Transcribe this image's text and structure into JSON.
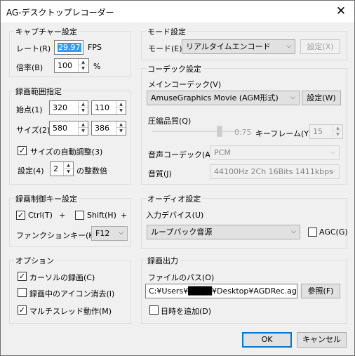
{
  "window": {
    "title": "AG-デスクトップレコーダー",
    "close_glyph": "✕"
  },
  "capture": {
    "legend": "キャプチャー設定",
    "rate_label": "レート(R)",
    "rate_value": "29.97",
    "rate_unit": "FPS",
    "scale_label": "倍率(B)",
    "scale_value": "100",
    "scale_unit": "%"
  },
  "area": {
    "legend": "録画範囲指定",
    "start_label": "始点(1)",
    "start_x": "320",
    "start_y": "110",
    "size_label": "サイズ(2)",
    "size_w": "580",
    "size_h": "386",
    "auto_adjust_label": "サイズの自動調整(3)",
    "auto_adjust_checked": true,
    "setting_label": "設定(4)",
    "multiple_value": "2",
    "multiple_suffix": "の整数倍"
  },
  "hotkey": {
    "legend": "録画制御キー設定",
    "ctrl_label": "Ctrl(T)",
    "ctrl_checked": true,
    "plus1": "+",
    "shift_label": "Shift(H)",
    "shift_checked": false,
    "plus2": "+",
    "function_key_label": "ファンクションキー(K)",
    "function_key_value": "F12"
  },
  "options": {
    "legend": "オプション",
    "cursor_label": "カーソルの録画(C)",
    "cursor_checked": true,
    "hide_icon_label": "録画中のアイコン消去(I)",
    "hide_icon_checked": false,
    "multithread_label": "マルチスレッド動作(M)",
    "multithread_checked": true
  },
  "mode": {
    "legend": "モード設定",
    "mode_label": "モード(E)",
    "mode_value": "リアルタイムエンコード",
    "settings_button": "設定(X)"
  },
  "codec": {
    "legend": "コーデック設定",
    "main_label": "メインコーデック(V)",
    "main_value": "AmuseGraphics Movie (AGM形式)",
    "main_settings_button": "設定(W)",
    "quality_label": "圧縮品質(Q)",
    "quality_value": "0.75",
    "quality_level": 0.75,
    "keyframe_label": "キーフレーム(Y)",
    "keyframe_value": "15",
    "audio_codec_label": "音声コーデック(A)",
    "audio_codec_value": "PCM",
    "audio_quality_label": "音質(J)",
    "audio_quality_value": "44100Hz 2Ch 16Bits 1411kbps"
  },
  "audio": {
    "legend": "オーディオ設定",
    "input_label": "入力デバイス(U)",
    "input_value": "ループバック音源",
    "agc_label": "AGC(G)",
    "agc_checked": false
  },
  "output": {
    "legend": "録画出力",
    "path_label": "ファイルのパス(O)",
    "path_value": "C:¥Users¥████¥Desktop¥AGDRec.agm",
    "browse_button": "参照(F)",
    "add_datetime_label": "日時を追加(D)",
    "add_datetime_checked": false
  },
  "footer": {
    "ok_button": "OK",
    "cancel_button": "キャンセル"
  },
  "colors": {
    "accent": "#0078d7",
    "selection": "#3399ff",
    "dialog_bg": "#f0f0f0"
  }
}
